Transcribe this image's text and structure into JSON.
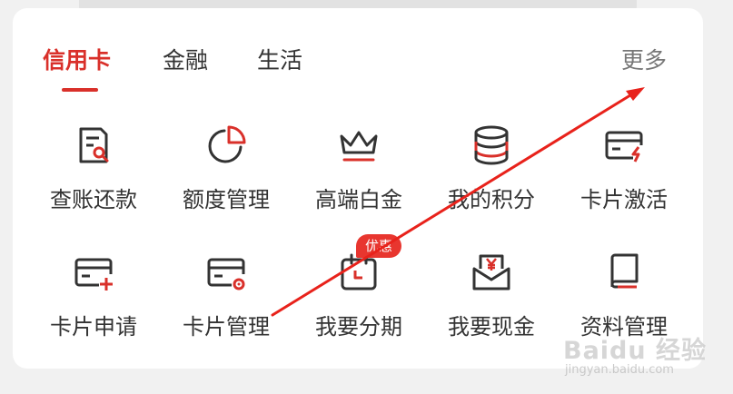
{
  "tabs": [
    {
      "label": "信用卡",
      "active": true
    },
    {
      "label": "金融",
      "active": false
    },
    {
      "label": "生活",
      "active": false
    }
  ],
  "more_label": "更多",
  "accent_color": "#d9302a",
  "grid": [
    {
      "label": "查账还款",
      "icon": "bill-search-icon"
    },
    {
      "label": "额度管理",
      "icon": "pie-chart-icon"
    },
    {
      "label": "高端白金",
      "icon": "crown-icon"
    },
    {
      "label": "我的积分",
      "icon": "coin-stack-icon"
    },
    {
      "label": "卡片激活",
      "icon": "card-lightning-icon"
    },
    {
      "label": "卡片申请",
      "icon": "card-plus-icon"
    },
    {
      "label": "卡片管理",
      "icon": "card-gear-icon"
    },
    {
      "label": "我要分期",
      "icon": "calendar-icon"
    },
    {
      "label": "我要现金",
      "icon": "envelope-yen-icon"
    },
    {
      "label": "资料管理",
      "icon": "book-icon"
    }
  ],
  "badge": "优惠",
  "watermark": {
    "main": "Baidu 经验",
    "sub": "jingyan.baidu.com"
  }
}
